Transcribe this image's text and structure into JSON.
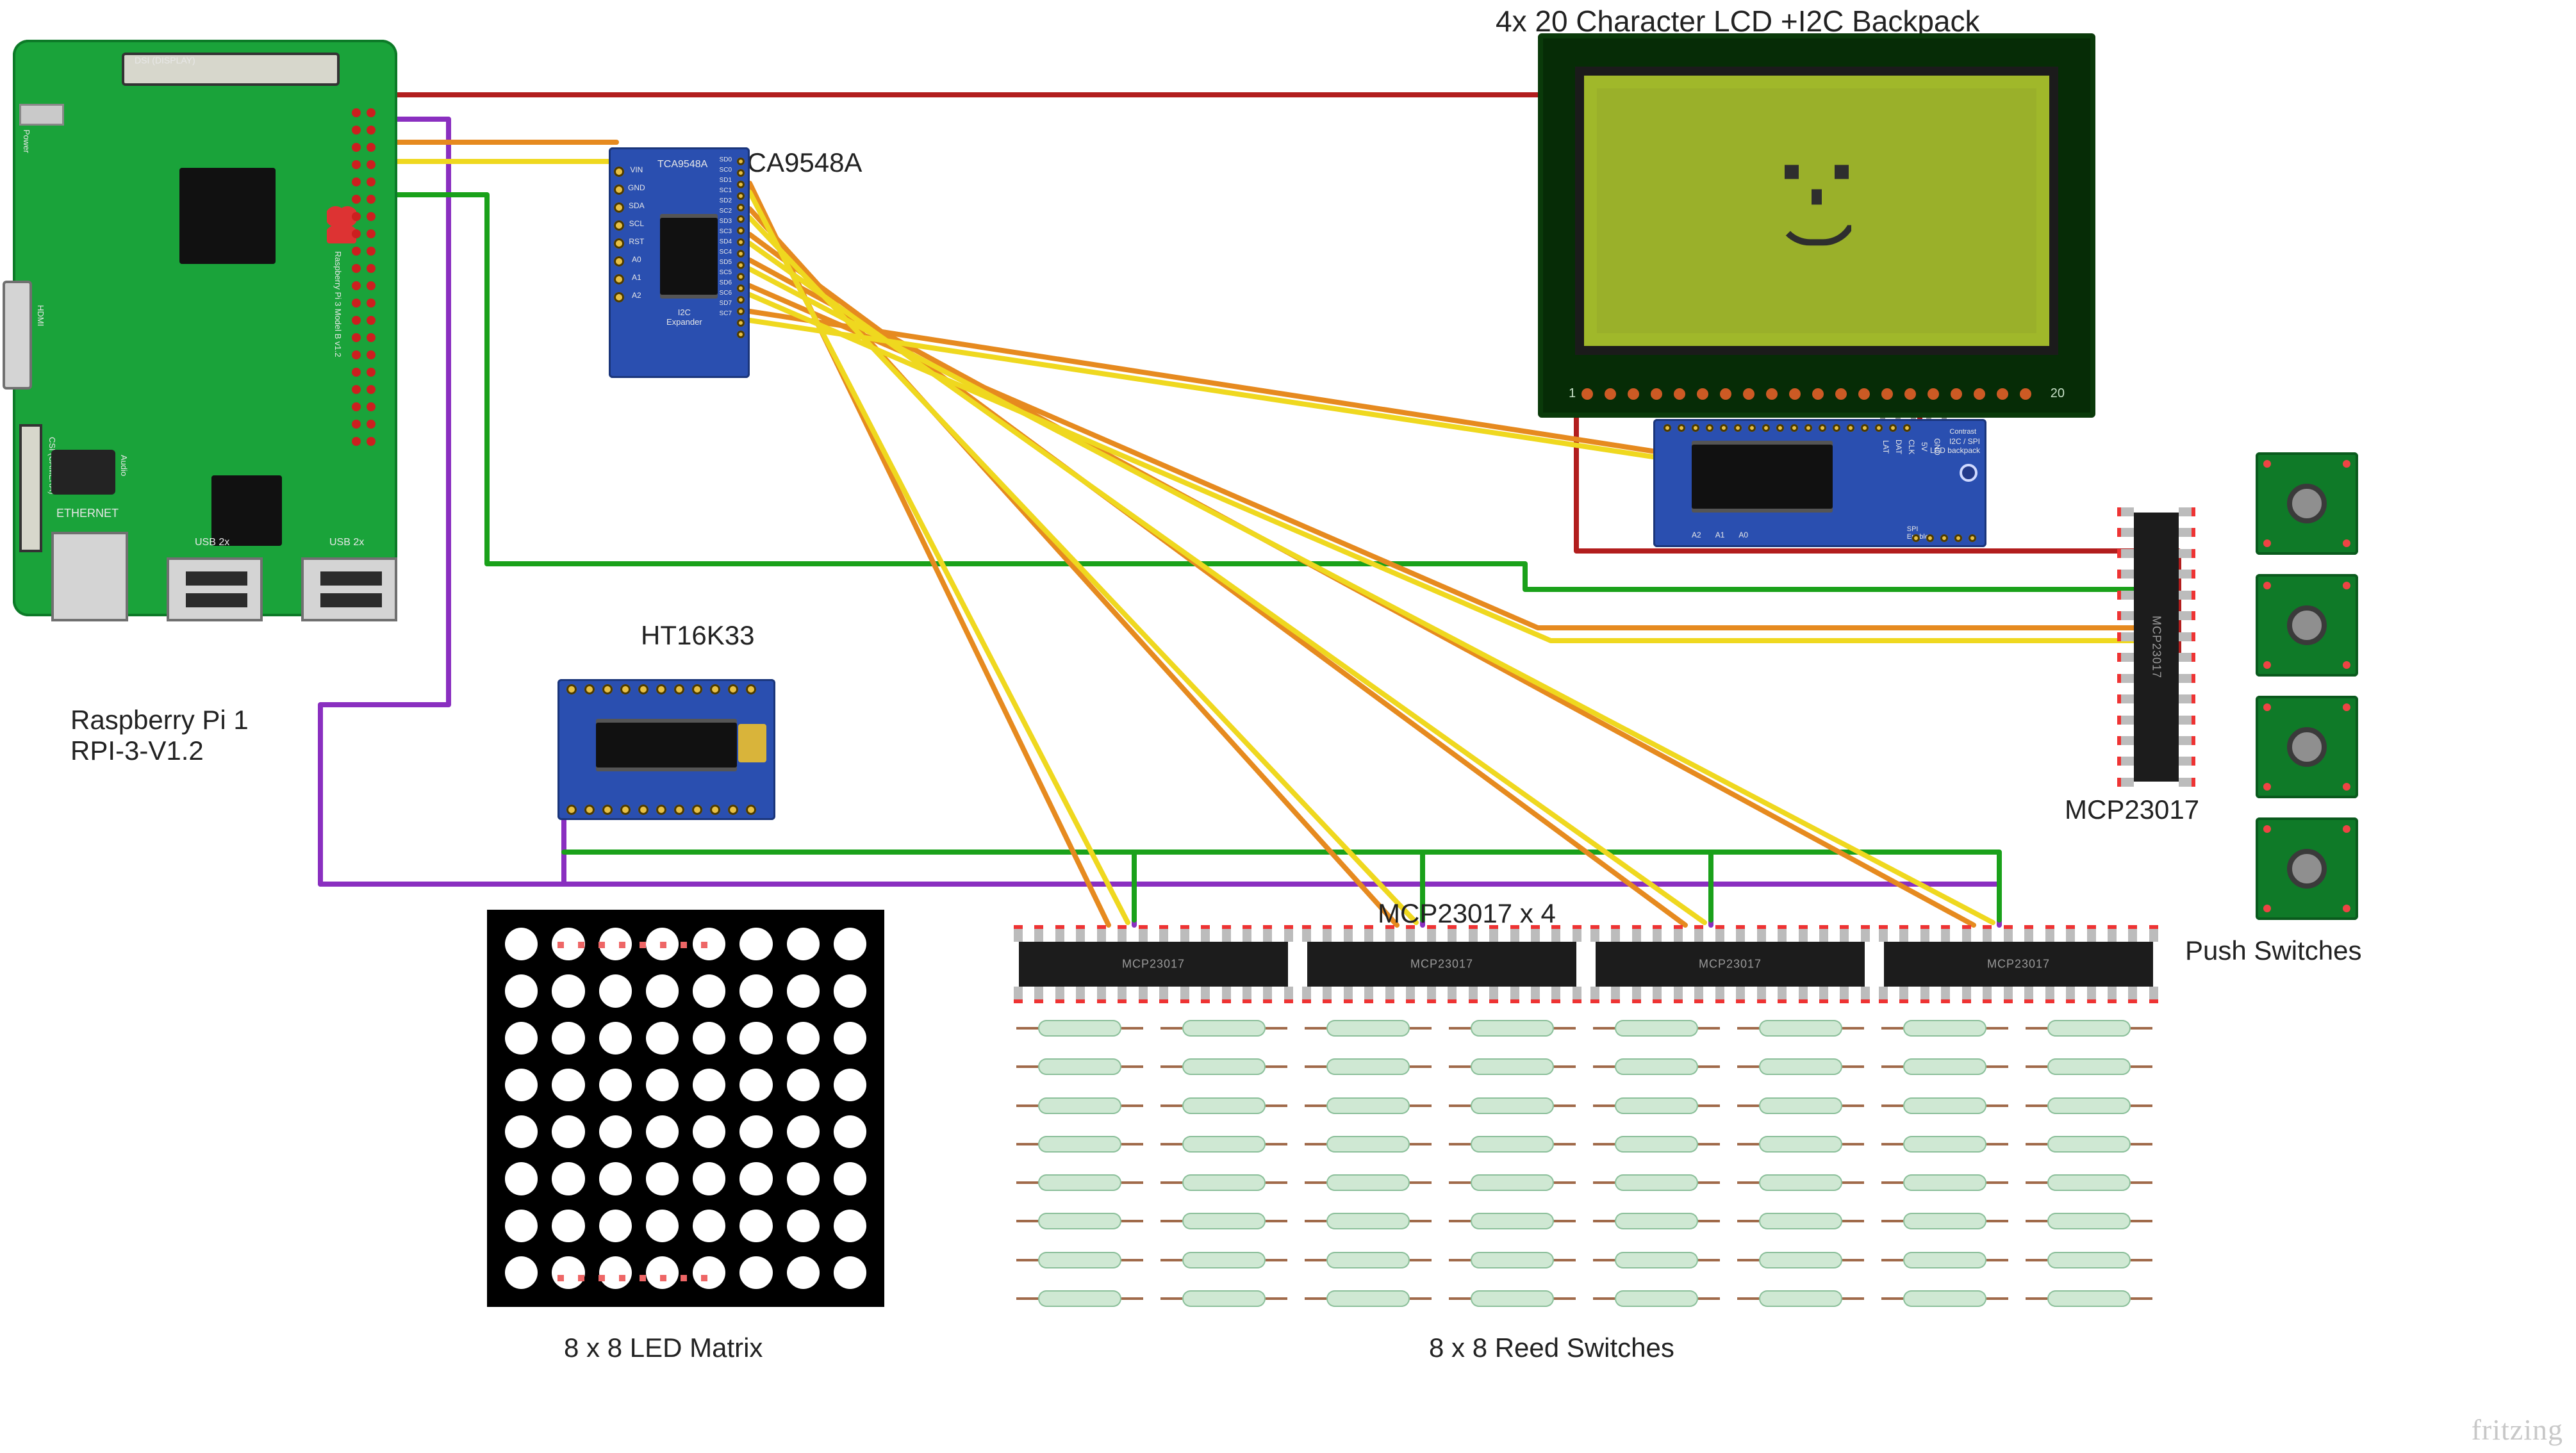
{
  "title_lcd": "4x 20 Character LCD +I2C Backpack",
  "labels": {
    "rpi": "Raspberry Pi 1\nRPI-3-V1.2",
    "tca": "TCA9548A",
    "htk": "HT16K33",
    "mcp_vert": "MCP23017",
    "mcp_x4": "MCP23017 x 4",
    "led_matrix": "8 x 8 LED Matrix",
    "reed": "8 x 8 Reed Switches",
    "push": "Push Switches",
    "watermark": "fritzing"
  },
  "rpi": {
    "dsi": "DSI (DISPLAY)",
    "csi": "CSI (CAMERA)",
    "eth": "ETHERNET",
    "usb": "USB 2x",
    "power": "Power",
    "hdmi": "HDMI",
    "audio": "Audio",
    "board_text": "Raspberry Pi 3 Model B v1.2"
  },
  "tca_silk": {
    "name": "TCA9548A",
    "sub": "I2C\nExpander",
    "lpins": [
      "VIN",
      "GND",
      "SDA",
      "SCL",
      "RST",
      "A0",
      "A1",
      "A2"
    ],
    "rpins": [
      "SD0",
      "SC0",
      "SD1",
      "SC1",
      "SD2",
      "SC2",
      "SD3",
      "SC3",
      "SD4",
      "SC4",
      "SD5",
      "SC5",
      "SD6",
      "SC6",
      "SD7",
      "SC7"
    ]
  },
  "ht_silk": {
    "name": "HT16K33"
  },
  "mcp_silk": "MCP23017",
  "backpack_silk": {
    "toppins": [
      "LAT",
      "DAT",
      "CLK",
      "5V",
      "GND"
    ],
    "title": "I2C / SPI\nLCD backpack",
    "jumpers": [
      "A2",
      "A1",
      "A0"
    ],
    "spi": "SPI\nEnable",
    "contrast": "Contrast"
  },
  "lcd_pins": {
    "left": "1",
    "right": "20"
  },
  "wire_colors": {
    "vcc": "#b21e1e",
    "gnd": "#8a2fc0",
    "scl": "#e68a1f",
    "sda": "#efd81f",
    "i2c_int": "#1aa11a"
  }
}
